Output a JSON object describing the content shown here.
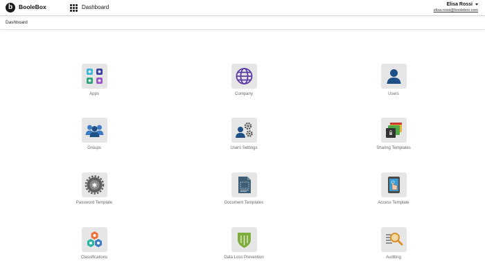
{
  "header": {
    "brand": "BooleBox",
    "page_title": "Dashboard",
    "user_name": "Elisa Rossi",
    "user_email": "elisa.rossi@boolebox.com"
  },
  "breadcrumb": "Dashboard",
  "tiles": [
    {
      "label": "Apps",
      "icon": "apps-icon"
    },
    {
      "label": "Company",
      "icon": "globe-icon"
    },
    {
      "label": "Users",
      "icon": "user-icon"
    },
    {
      "label": "Groups",
      "icon": "group-icon"
    },
    {
      "label": "Users Settings",
      "icon": "user-settings-icon"
    },
    {
      "label": "Sharing Templates",
      "icon": "sharing-templates-icon"
    },
    {
      "label": "Password Template",
      "icon": "password-gear-icon"
    },
    {
      "label": "Document Templates",
      "icon": "document-template-icon"
    },
    {
      "label": "Access Template",
      "icon": "access-tablet-icon"
    },
    {
      "label": "Classifications",
      "icon": "classifications-hex-icon"
    },
    {
      "label": "Data Loss Prevention",
      "icon": "shield-icon"
    },
    {
      "label": "Auditing",
      "icon": "audit-magnifier-icon"
    }
  ],
  "colors": {
    "accent_blue": "#2d5f9e",
    "purple": "#5b3aa6",
    "tile_bg": "#e6e6e6"
  }
}
